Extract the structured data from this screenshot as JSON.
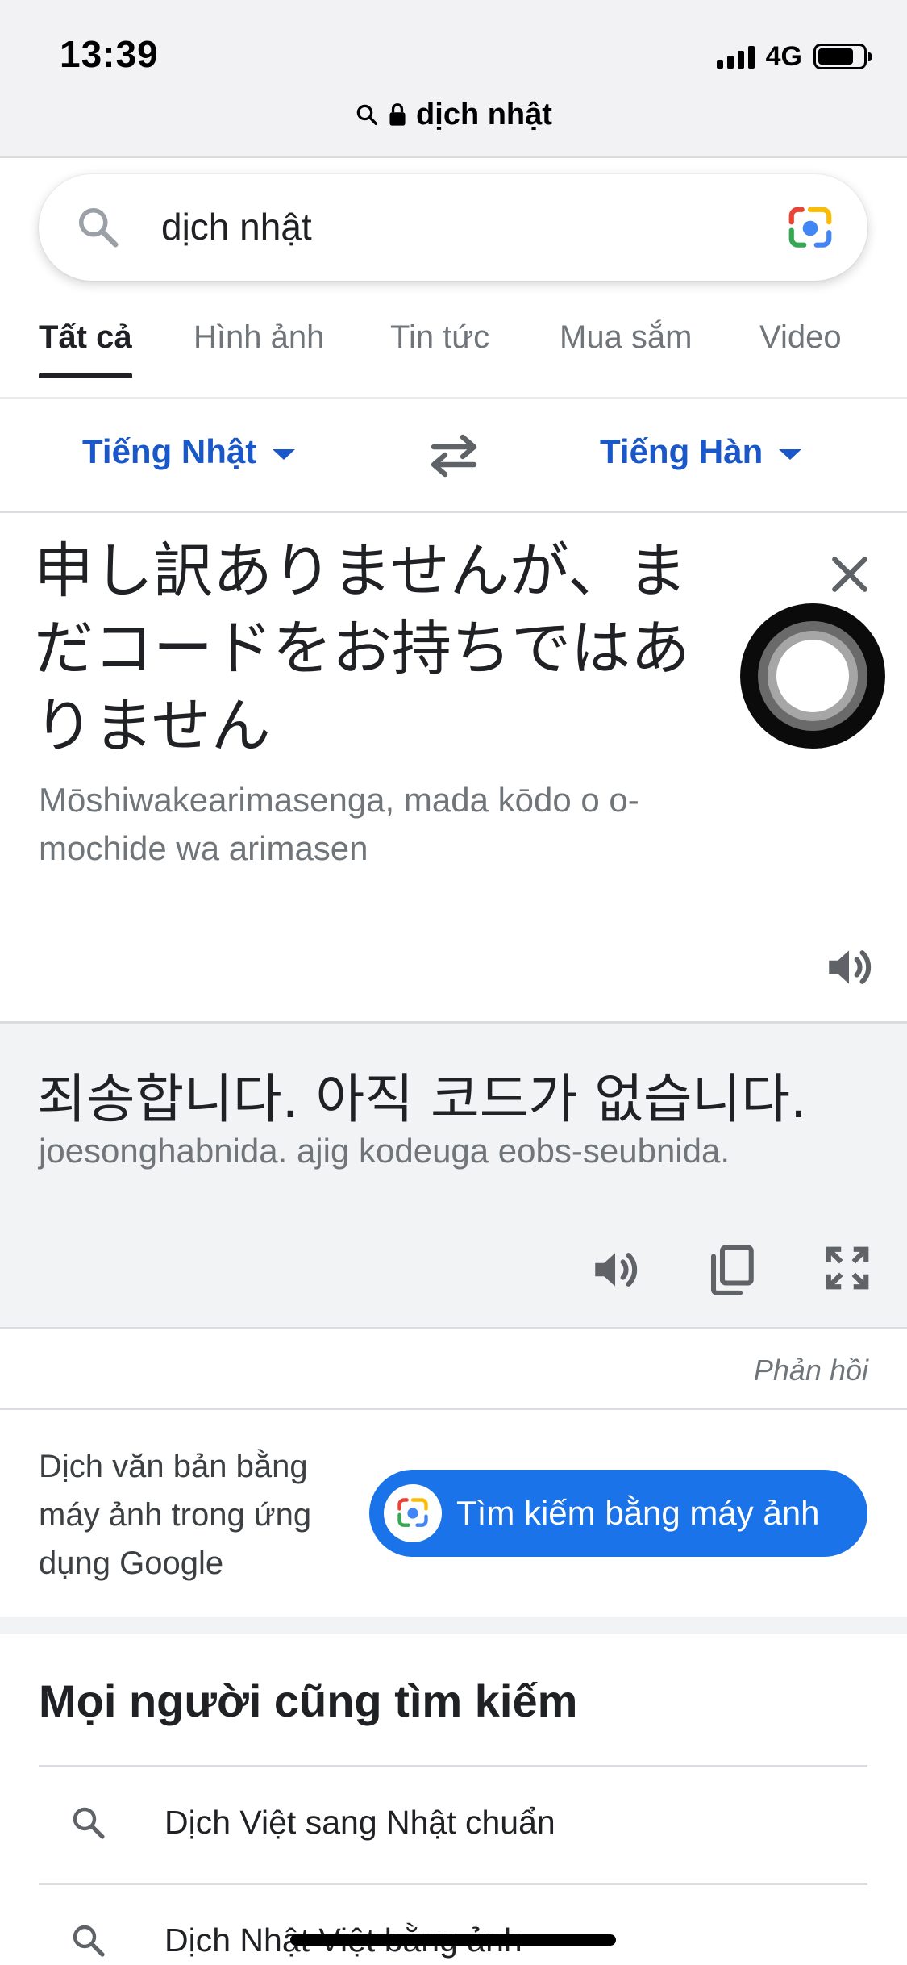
{
  "status_bar": {
    "time": "13:39",
    "network": "4G",
    "battery_level": 0.8
  },
  "url_bar": {
    "text": "dịch nhật"
  },
  "search": {
    "query": "dịch nhật"
  },
  "tabs": [
    {
      "label": "Tất cả",
      "active": true
    },
    {
      "label": "Hình ảnh",
      "active": false
    },
    {
      "label": "Tin tức",
      "active": false
    },
    {
      "label": "Mua sắm",
      "active": false
    },
    {
      "label": "Video",
      "active": false
    }
  ],
  "translator": {
    "source_language": "Tiếng Nhật",
    "target_language": "Tiếng Hàn",
    "source_text": "申し訳ありませんが、まだコードをお持ちではありません",
    "source_transliteration": "Mōshiwakearimasenga, mada kōdo o o-mochide wa arimasen",
    "target_text": "죄송합니다. 아직 코드가 없습니다.",
    "target_transliteration": "joesonghabnida. ajig kodeuga eobs-seubnida.",
    "feedback_label": "Phản hồi"
  },
  "camera_promo": {
    "text": "Dịch văn bản bằng máy ảnh trong ứng dụng Google",
    "button_label": "Tìm kiếm bằng máy ảnh"
  },
  "people_also_search": {
    "title": "Mọi người cũng tìm kiếm",
    "items": [
      "Dịch Việt sang Nhật chuẩn",
      "Dịch Nhật Việt bằng ảnh"
    ]
  },
  "colors": {
    "accent_blue": "#1a73e8",
    "language_blue": "#1a57c9",
    "panel_gray": "#f1f3f4"
  },
  "icons": [
    "search-icon",
    "lock-icon",
    "google-lens-icon",
    "chevron-down-icon",
    "swap-icon",
    "close-icon",
    "speaker-icon",
    "copy-icon",
    "expand-icon",
    "camera-icon"
  ]
}
